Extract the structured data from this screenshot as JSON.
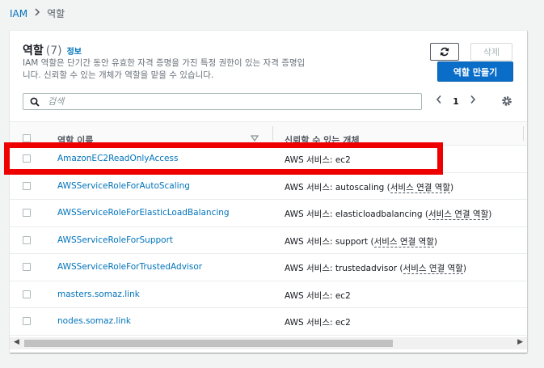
{
  "breadcrumb": {
    "root": "IAM",
    "current": "역할"
  },
  "header": {
    "title": "역할",
    "count": "(7)",
    "info": "정보",
    "description_line1": "IAM 역할은 단기간 동안 유효한 자격 증명을 가진 특정 권한이 있는 자격 증명입",
    "description_line2": "니다. 신뢰할 수 있는 개체가 역할을 맡을 수 있습니다."
  },
  "buttons": {
    "delete": "삭제",
    "create": "역할 만들기"
  },
  "search": {
    "placeholder": "검색",
    "value": ""
  },
  "pagination": {
    "page": "1"
  },
  "columns": {
    "name": "역할 이름",
    "trusted": "신뢰할 수 있는 개체"
  },
  "rows": [
    {
      "name": "AmazonEC2ReadOnlyAccess",
      "trusted_prefix": "AWS 서비스: ec2",
      "trusted_link": "",
      "trusted_close": ""
    },
    {
      "name": "AWSServiceRoleForAutoScaling",
      "trusted_prefix": "AWS 서비스: autoscaling (",
      "trusted_link": "서비스 연결 역할",
      "trusted_close": ")"
    },
    {
      "name": "AWSServiceRoleForElasticLoadBalancing",
      "trusted_prefix": "AWS 서비스: elasticloadbalancing (",
      "trusted_link": "서비스 연결 역할",
      "trusted_close": ")"
    },
    {
      "name": "AWSServiceRoleForSupport",
      "trusted_prefix": "AWS 서비스: support (",
      "trusted_link": "서비스 연결 역할",
      "trusted_close": ")"
    },
    {
      "name": "AWSServiceRoleForTrustedAdvisor",
      "trusted_prefix": "AWS 서비스: trustedadvisor (",
      "trusted_link": "서비스 연결 역할",
      "trusted_close": ")"
    },
    {
      "name": "masters.somaz.link",
      "trusted_prefix": "AWS 서비스: ec2",
      "trusted_link": "",
      "trusted_close": ""
    },
    {
      "name": "nodes.somaz.link",
      "trusted_prefix": "AWS 서비스: ec2",
      "trusted_link": "",
      "trusted_close": ""
    }
  ],
  "colors": {
    "link": "#0073bb",
    "primary_button": "#0a6ec9",
    "highlight_box": "#ee0000"
  },
  "icons": [
    "chevron-right-icon",
    "refresh-icon",
    "search-icon",
    "chevron-left-icon",
    "settings-gear-icon",
    "sort-caret-icon"
  ]
}
